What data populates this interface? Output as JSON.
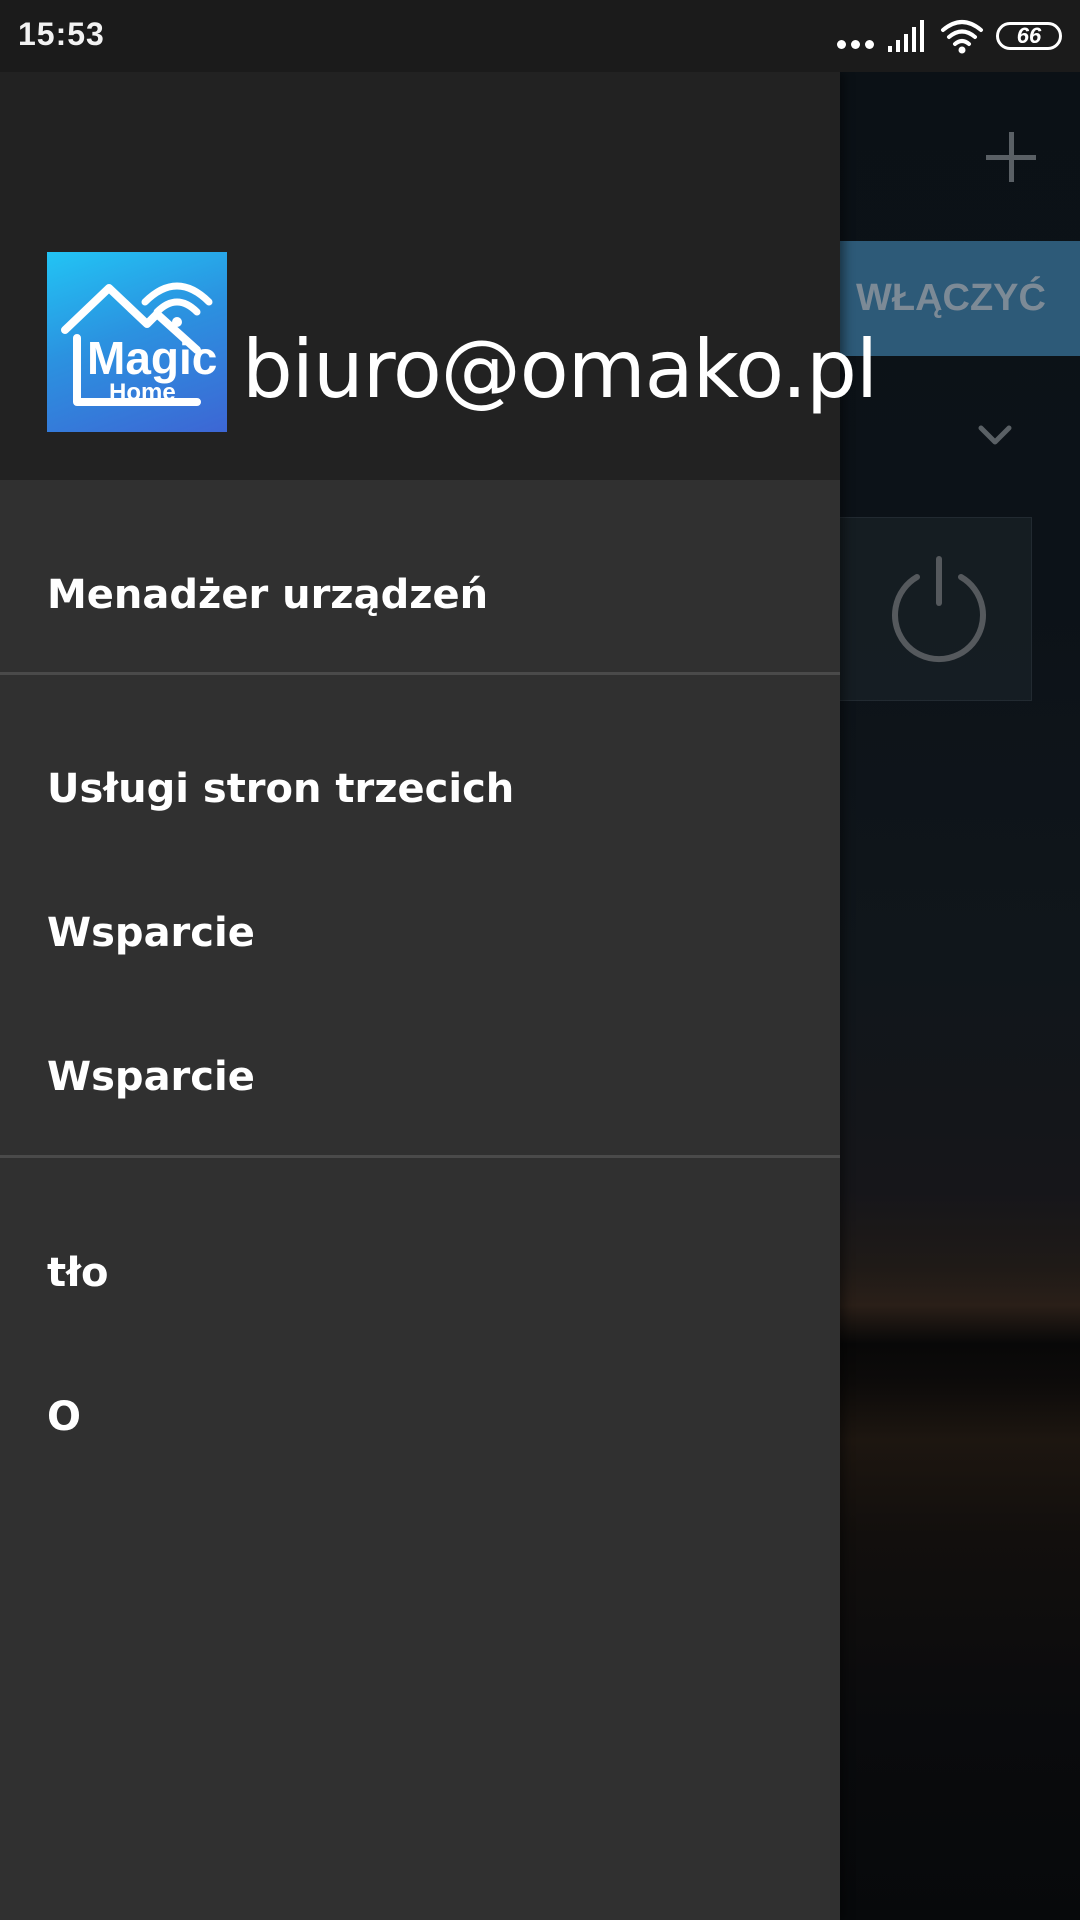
{
  "status_bar": {
    "time": "15:53",
    "battery_level": "66",
    "icons": [
      "more-dots-icon",
      "signal-icon",
      "wifi-icon",
      "battery-icon"
    ]
  },
  "background_app": {
    "add_icon": "plus-icon",
    "turn_on_label": "WŁĄCZYĆ",
    "chevron_icon": "chevron-down-icon",
    "power_icon": "power-icon"
  },
  "drawer": {
    "header": {
      "logo_text_main": "Magic",
      "logo_text_sub": "Home",
      "email": "biuro@omako.pl"
    },
    "items": [
      {
        "label": "Menadżer urządzeń"
      },
      {
        "label": "Usługi stron trzecich"
      },
      {
        "label": "Wsparcie"
      },
      {
        "label": "Wsparcie"
      },
      {
        "label": "tło"
      },
      {
        "label": "O"
      }
    ]
  },
  "colors": {
    "drawer_bg": "#303030",
    "drawer_header_bg": "#222222",
    "status_bar_bg": "#1b1b1b",
    "accent_button": "#2d5a78"
  }
}
